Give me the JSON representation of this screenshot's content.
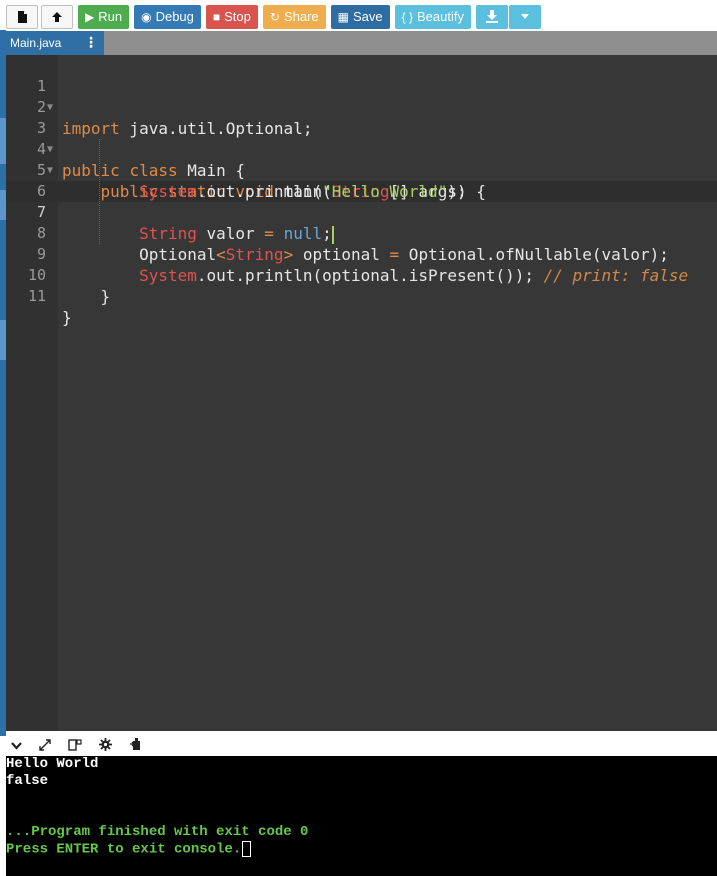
{
  "toolbar": {
    "new_file_icon": "file-icon",
    "upload_icon": "upload-icon",
    "run_label": "Run",
    "debug_label": "Debug",
    "stop_label": "Stop",
    "share_label": "Share",
    "save_label": "Save",
    "beautify_label": "Beautify",
    "beautify_glyph": "{ }",
    "download_icon": "download-icon",
    "dropdown_icon": "caret-down-icon"
  },
  "tabs": [
    {
      "label": "Main.java",
      "active": true
    }
  ],
  "editor": {
    "language": "java",
    "active_line": 7,
    "lines": [
      {
        "num": "1",
        "text": "import java.util.Optional;"
      },
      {
        "num": "2",
        "text": ""
      },
      {
        "num": "3",
        "text": "public class Main {"
      },
      {
        "num": "4",
        "text": "    public static void main(String[] args) {"
      },
      {
        "num": "5",
        "text": "        System.out.println(\"Hello World\");"
      },
      {
        "num": "6",
        "text": ""
      },
      {
        "num": "7",
        "text": "        String valor = null;"
      },
      {
        "num": "8",
        "text": "        Optional<String> optional = Optional.ofNullable(valor);"
      },
      {
        "num": "9",
        "text": "        System.out.println(optional.isPresent()); // print: false"
      },
      {
        "num": "10",
        "text": "    }"
      },
      {
        "num": "11",
        "text": "}"
      }
    ]
  },
  "console_toolbar": {
    "icons": [
      "chevron-down-icon",
      "expand-icon",
      "copy-icon",
      "settings-icon",
      "input-icon"
    ]
  },
  "console": {
    "output": [
      "Hello World",
      "false"
    ],
    "finished_message": "...Program finished with exit code 0",
    "exit_prompt": "Press ENTER to exit console."
  },
  "colors": {
    "run": "#4dac4d",
    "debug": "#337ab7",
    "stop": "#d9534f",
    "share": "#f0ad4e",
    "save": "#2e6da4",
    "beautify": "#5bc0de",
    "editor_bg": "#373737",
    "console_bg": "#000000",
    "console_msg": "#64c84a"
  }
}
